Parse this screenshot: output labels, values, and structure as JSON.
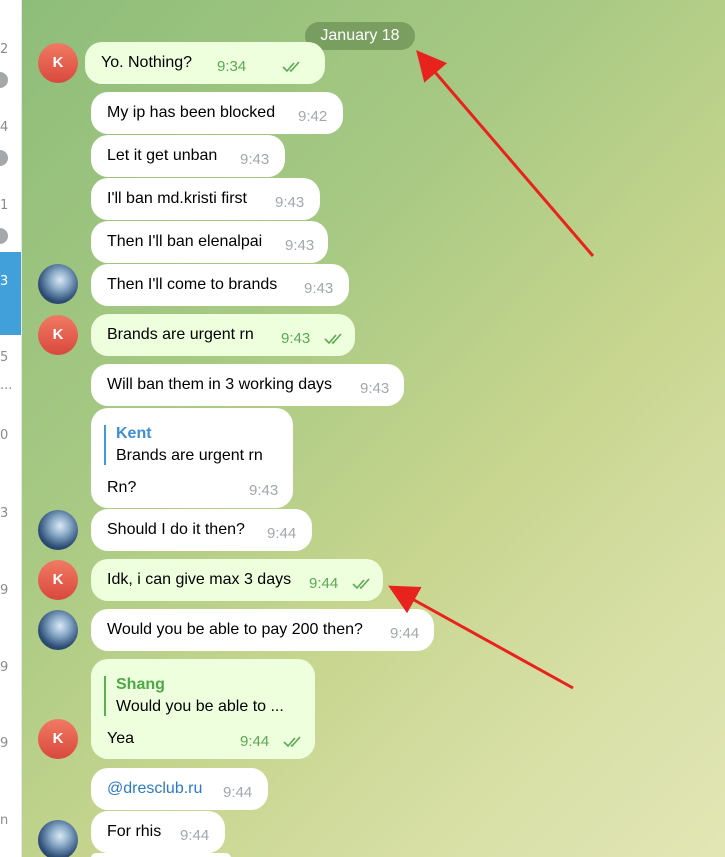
{
  "sidebar": {
    "numbers": [
      "2",
      "4",
      "1",
      "3",
      "5",
      "...",
      "0",
      "3",
      "9",
      "9",
      "9",
      "n"
    ],
    "selected_number": "3"
  },
  "chat": {
    "date_label": "January 18",
    "messages": [
      {
        "text": "Yo. Nothing?",
        "time": "9:34",
        "dir": "out"
      },
      {
        "text": "My ip has been blocked",
        "time": "9:42",
        "dir": "in"
      },
      {
        "text": "Let it get unban",
        "time": "9:43",
        "dir": "in"
      },
      {
        "text": "I'll ban md.kristi first",
        "time": "9:43",
        "dir": "in"
      },
      {
        "text": "Then I'll ban elenalpai",
        "time": "9:43",
        "dir": "in"
      },
      {
        "text": "Then I'll come to brands",
        "time": "9:43",
        "dir": "in"
      },
      {
        "text": "Brands are urgent rn",
        "time": "9:43",
        "dir": "out"
      },
      {
        "text": "Will ban them in 3 working days",
        "time": "9:43",
        "dir": "in"
      },
      {
        "reply_name": "Kent",
        "reply_text": "Brands are urgent rn",
        "text": "Rn?",
        "time": "9:43",
        "dir": "in"
      },
      {
        "text": "Should I do it then?",
        "time": "9:44",
        "dir": "in"
      },
      {
        "text": "Idk, i can give max 3 days",
        "time": "9:44",
        "dir": "out"
      },
      {
        "text": "Would you be able to pay 200 then?",
        "time": "9:44",
        "dir": "in"
      },
      {
        "reply_name": "Shang",
        "reply_text": "Would you be able to ...",
        "text": "Yea",
        "time": "9:44",
        "dir": "out"
      },
      {
        "text": "@dresclub.ru",
        "time": "9:44",
        "dir": "in"
      },
      {
        "text": "For rhis",
        "time": "9:44",
        "dir": "in"
      }
    ]
  },
  "avatars": {
    "kent_initial": "K"
  },
  "colors": {
    "accent": "#419fd9",
    "out_bubble": "#eeffde",
    "in_bubble": "#ffffff",
    "arrow": "#e8231d",
    "check": "#5ca853"
  },
  "icons": {
    "read_receipt": "double-check-icon",
    "arrow": "red-arrow-annotation"
  }
}
